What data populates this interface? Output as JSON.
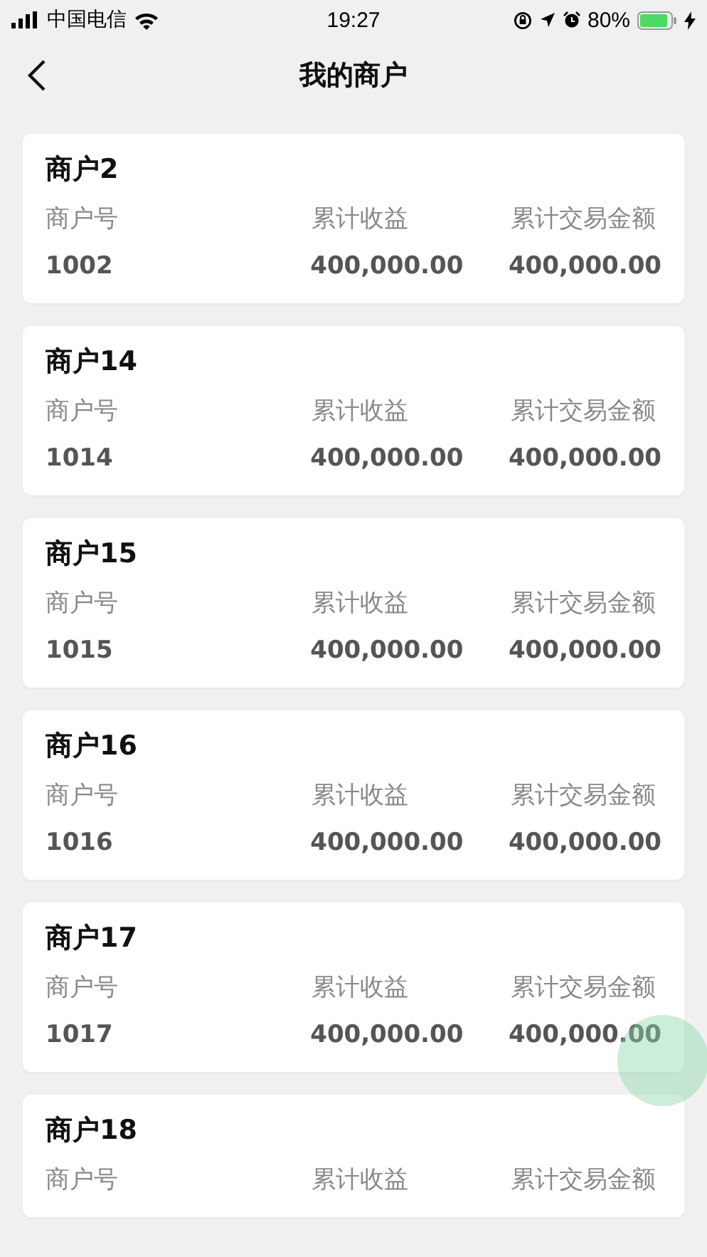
{
  "status_bar": {
    "carrier": "中国电信",
    "time": "19:27",
    "battery": "80%"
  },
  "nav": {
    "title": "我的商户"
  },
  "merchants": [
    {
      "name": "商户2",
      "labels": [
        "商户号",
        "累计收益",
        "累计交易金额"
      ],
      "values": [
        "1002",
        "400,000.00",
        "400,000.00"
      ]
    },
    {
      "name": "商户14",
      "labels": [
        "商户号",
        "累计收益",
        "累计交易金额"
      ],
      "values": [
        "1014",
        "400,000.00",
        "400,000.00"
      ]
    },
    {
      "name": "商户15",
      "labels": [
        "商户号",
        "累计收益",
        "累计交易金额"
      ],
      "values": [
        "1015",
        "400,000.00",
        "400,000.00"
      ]
    },
    {
      "name": "商户16",
      "labels": [
        "商户号",
        "累计收益",
        "累计交易金额"
      ],
      "values": [
        "1016",
        "400,000.00",
        "400,000.00"
      ]
    },
    {
      "name": "商户17",
      "labels": [
        "商户号",
        "累计收益",
        "累计交易金额"
      ],
      "values": [
        "1017",
        "400,000.00",
        "400,000.00"
      ]
    },
    {
      "name": "商户18",
      "labels": [
        "商户号",
        "累计收益",
        "累计交易金额"
      ]
    }
  ]
}
